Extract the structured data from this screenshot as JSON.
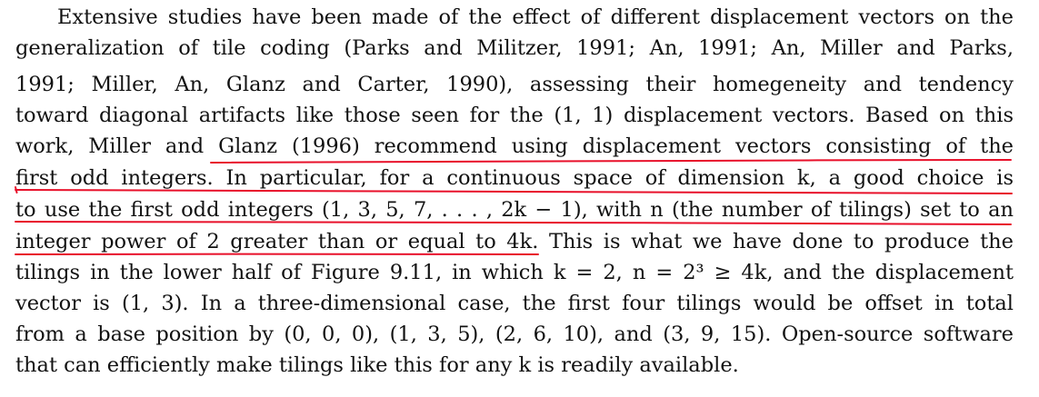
{
  "paragraph": {
    "lines": [
      "Extensive studies have been made of the effect of different displacement vectors on the",
      "generalization of tile coding (Parks and Militzer, 1991; An, 1991; An, Miller and Parks,",
      "1991; Miller, An, Glanz and Carter, 1990), assessing their homegeneity and tendency",
      "toward diagonal artifacts like those seen for the (1, 1) displacement vectors. Based on this",
      "work, Miller and Glanz (1996) recommend using displacement vectors consisting of the",
      "first odd integers. In particular, for a continuous space of dimension k, a good choice is",
      "to use the first odd integers (1, 3, 5, 7, . . . , 2k − 1), with n (the number of tilings) set to an",
      "integer power of 2 greater than or equal to 4k. This is what we have done to produce the",
      "tilings in the lower half of Figure 9.11, in which k = 2, n = 2³ ≥ 4k, and the displacement",
      "vector is (1, 3). In a three-dimensional case, the first four tilings would be offset in total",
      "from a base position by (0, 0, 0), (1, 3, 5), (2, 6, 10), and (3, 9, 15). Open-source software",
      "that can efficiently make tilings like this for any k is readily available."
    ]
  },
  "highlight": {
    "color": "#e8102a",
    "tool": "hand-drawn underline"
  }
}
